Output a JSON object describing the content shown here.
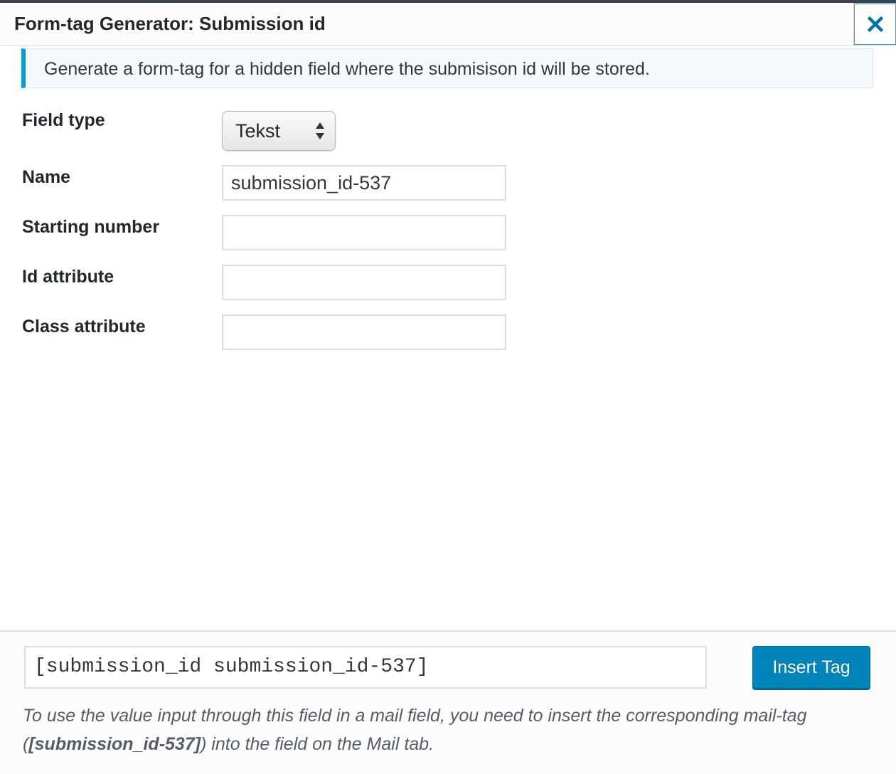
{
  "dialog": {
    "title": "Form-tag Generator: Submission id",
    "close_icon": "close-x-icon",
    "accent_color": "#00a0d2"
  },
  "notice": {
    "text": "Generate a form-tag for a hidden field where the submisison id will be stored."
  },
  "form": {
    "field_type": {
      "label": "Field type",
      "selected": "Tekst"
    },
    "name": {
      "label": "Name",
      "value": "submission_id-537"
    },
    "starting_number": {
      "label": "Starting number",
      "value": ""
    },
    "id_attribute": {
      "label": "Id attribute",
      "value": ""
    },
    "class_attribute": {
      "label": "Class attribute",
      "value": ""
    }
  },
  "footer": {
    "tag": "[submission_id submission_id-537]",
    "insert_label": "Insert Tag",
    "insert_color": "#0085ba",
    "hint_before": "To use the value input through this field in a mail field, you need to insert the corresponding mail-tag (",
    "hint_tag": "[submission_id-537]",
    "hint_after": ") into the field on the Mail tab."
  }
}
